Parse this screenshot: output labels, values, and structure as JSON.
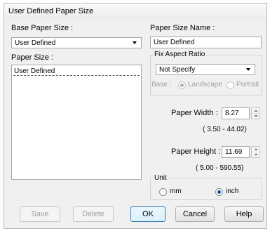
{
  "dialog": {
    "title": "User Defined Paper Size"
  },
  "base_paper_size": {
    "label": "Base Paper Size :",
    "value": "User Defined"
  },
  "paper_size_name": {
    "label": "Paper Size Name :",
    "value": "User Defined"
  },
  "paper_size_list": {
    "label": "Paper Size :",
    "items": [
      "User Defined"
    ]
  },
  "fix_aspect_ratio": {
    "label": "Fix Aspect Ratio",
    "value": "Not Specify",
    "base_label": "Base :",
    "landscape_label": "Landscape",
    "portrait_label": "Portrait",
    "selected": "Landscape",
    "enabled": false
  },
  "paper_width": {
    "label": "Paper Width :",
    "value": "8.27",
    "range": "( 3.50 - 44.02)"
  },
  "paper_height": {
    "label": "Paper Height :",
    "value": "11.69",
    "range": "( 5.00 - 590.55)"
  },
  "unit": {
    "label": "Unit",
    "mm_label": "mm",
    "inch_label": "inch",
    "selected": "inch"
  },
  "buttons": {
    "save": "Save",
    "delete": "Delete",
    "ok": "OK",
    "cancel": "Cancel",
    "help": "Help"
  },
  "colors": {
    "dialog_bg": "#f0f0f0",
    "radio_selected": "#1f4fa8",
    "default_button_border": "#3c7fb1"
  }
}
